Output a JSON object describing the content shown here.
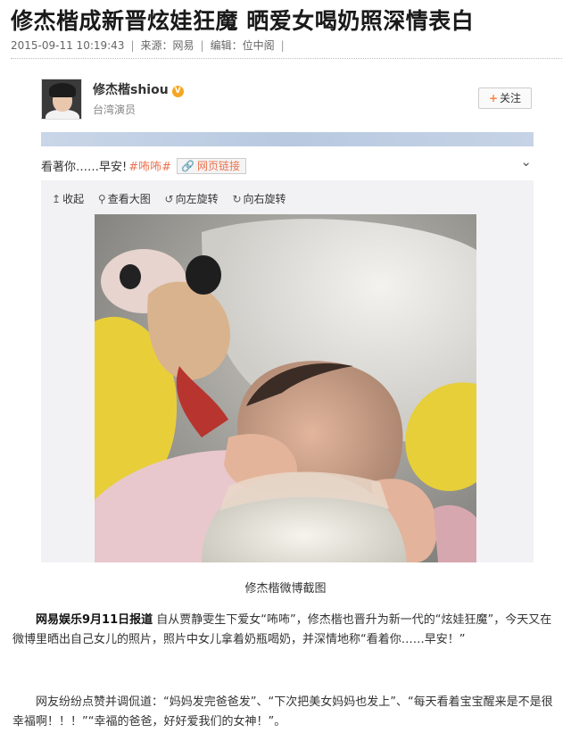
{
  "article": {
    "headline": "修杰楷成新晋炫娃狂魔 晒爱女喝奶照深情表白",
    "datetime": "2015-09-11 10:19:43",
    "source": "来源：网易",
    "editor": "编辑：位中阁"
  },
  "weibo": {
    "username": "修杰楷shiou",
    "verified_badge": "V",
    "user_title": "台湾演员",
    "follow_label": "关注",
    "post_text": "看著你……早安!",
    "hashtag": "#咘咘#",
    "web_link": "网页链接",
    "toolbar": {
      "collapse": "收起",
      "view_large": "查看大图",
      "rotate_left": "向左旋转",
      "rotate_right": "向右旋转"
    }
  },
  "caption": "修杰楷微博截图",
  "body": {
    "para1_lead": "网易娱乐9月11日报道",
    "para1_text": " 自从贾静雯生下爱女“咘咘”，修杰楷也晋升为新一代的“炫娃狂魔”，今天又在微博里晒出自己女儿的照片，照片中女儿拿着奶瓶喝奶，并深情地称“看着你……早安！”",
    "para2_text": "网友纷纷点赞并调侃道：“妈妈发完爸爸发”、“下次把美女妈妈也发上”、“每天看着宝宝醒来是不是很幸福啊！！！”“幸福的爸爸，好好爱我们的女神！”。"
  },
  "icons": {
    "follow": "plus-icon",
    "dropdown": "chevron-down-icon",
    "collapse": "arrow-up-icon",
    "view_large": "magnifier-icon",
    "rotate_left": "rotate-left-icon",
    "rotate_right": "rotate-right-icon",
    "link": "link-icon"
  },
  "colors": {
    "hashtag": "#eb7350",
    "follow_plus": "#ff8140",
    "verified": "#f5a623"
  }
}
